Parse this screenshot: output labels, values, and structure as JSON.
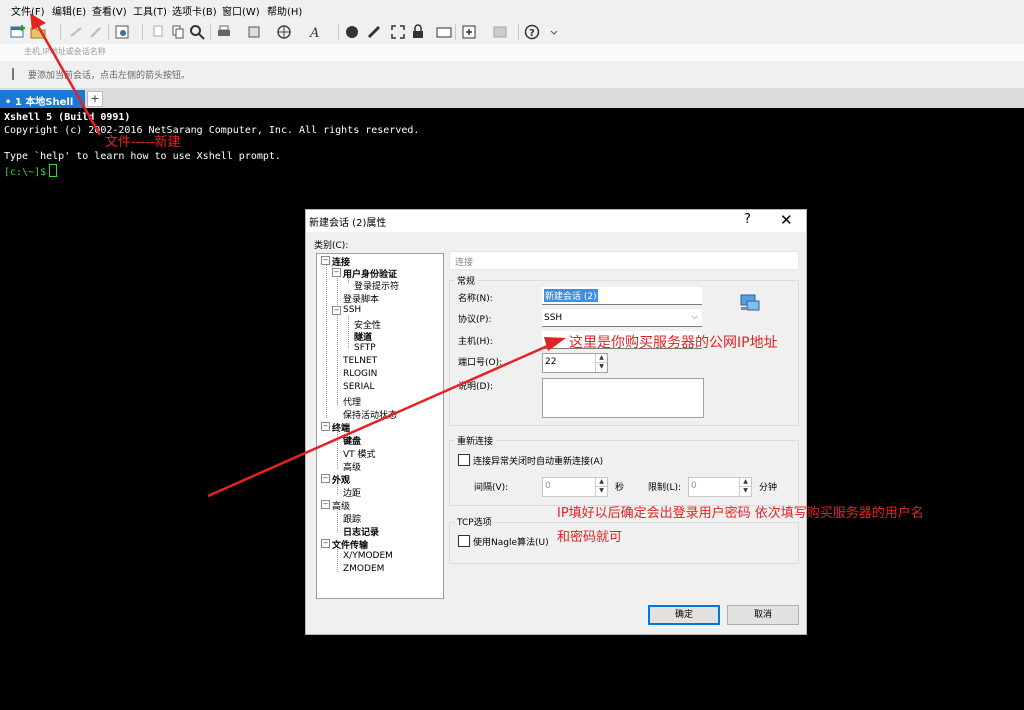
{
  "menu": [
    "文件(F)",
    "编辑(E)",
    "查看(V)",
    "工具(T)",
    "选项卡(B)",
    "窗口(W)",
    "帮助(H)"
  ],
  "address_placeholder": "主机,IP地址或会话名称",
  "hint_text": "要添加当前会话，点击左侧的箭头按钮。",
  "tab": {
    "label": "• 1 本地Shell",
    "add": "+"
  },
  "terminal": {
    "lines": [
      "Xshell 5 (Build 0991)",
      "Copyright (c) 2002-2016 NetSarang Computer, Inc. All rights reserved.",
      "",
      "Type `help' to learn how to use Xshell prompt."
    ],
    "prompt": "[c:\\~]$"
  },
  "dialog": {
    "title": "新建会话 (2)属性",
    "help": "?",
    "close": "✕",
    "category_label": "类别(C):",
    "tree": [
      {
        "label": "连接",
        "bold": true
      },
      {
        "label": "用户身份验证",
        "bold": true
      },
      {
        "label": "登录提示符",
        "bold": false
      },
      {
        "label": "登录脚本",
        "bold": false
      },
      {
        "label": "SSH",
        "bold": false
      },
      {
        "label": "安全性",
        "bold": false
      },
      {
        "label": "隧道",
        "bold": true
      },
      {
        "label": "SFTP",
        "bold": false
      },
      {
        "label": "TELNET",
        "bold": false
      },
      {
        "label": "RLOGIN",
        "bold": false
      },
      {
        "label": "SERIAL",
        "bold": false
      },
      {
        "label": "代理",
        "bold": false
      },
      {
        "label": "保持活动状态",
        "bold": false
      },
      {
        "label": "终端",
        "bold": true
      },
      {
        "label": "键盘",
        "bold": true
      },
      {
        "label": "VT 模式",
        "bold": false
      },
      {
        "label": "高级",
        "bold": false
      },
      {
        "label": "外观",
        "bold": true
      },
      {
        "label": "边距",
        "bold": false
      },
      {
        "label": "高级",
        "bold": false
      },
      {
        "label": "跟踪",
        "bold": false
      },
      {
        "label": "日志记录",
        "bold": true
      },
      {
        "label": "文件传输",
        "bold": true
      },
      {
        "label": "X/YMODEM",
        "bold": false
      },
      {
        "label": "ZMODEM",
        "bold": false
      }
    ],
    "section_title": "连接",
    "general_label": "常规",
    "name_label": "名称(N):",
    "name_value": "新建会话 (2)",
    "protocol_label": "协议(P):",
    "protocol_value": "SSH",
    "host_label": "主机(H):",
    "host_value": "",
    "port_label": "端口号(O):",
    "port_value": "22",
    "desc_label": "说明(D):",
    "reconnect_group": "重新连接",
    "reconnect_checkbox": "连接异常关闭时自动重新连接(A)",
    "interval_label": "间隔(V):",
    "interval_value": "0",
    "sec_unit": "秒",
    "limit_label": "限制(L):",
    "limit_value": "0",
    "min_unit": "分钟",
    "tcp_group": "TCP选项",
    "nagle_label": "使用Nagle算法(U)",
    "ok": "确定",
    "cancel": "取消"
  },
  "annotations": {
    "file_new": "文件-----新建",
    "host_note": "这里是你购买服务器的公网IP地址",
    "after_note_1": "IP填好以后确定会出登录用户密码 依次填写购买服务器的用户名",
    "after_note_2": "和密码就可"
  },
  "colors": {
    "annotation": "#e52222",
    "tab_active": "#1a78d6",
    "terminal_bg": "#000000",
    "prompt": "#39d739"
  }
}
